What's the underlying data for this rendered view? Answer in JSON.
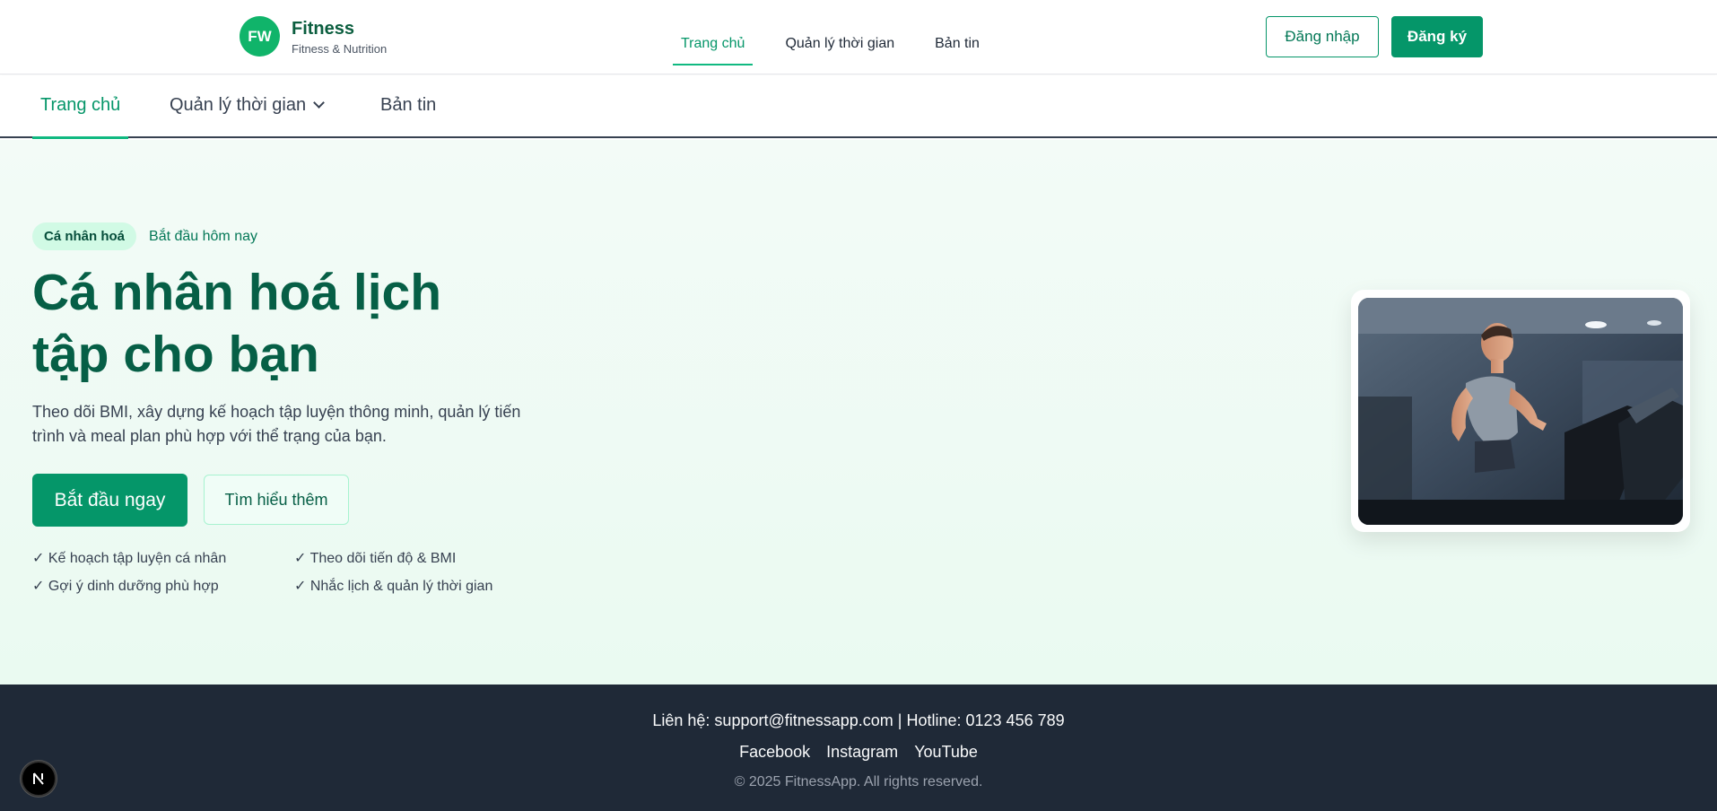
{
  "brand": {
    "logo_text": "FW",
    "name": "Fitness",
    "subtitle": "Fitness & Nutrition",
    "logo_color": "#10b46a"
  },
  "top_nav": {
    "items": [
      {
        "label": "Trang chủ",
        "active": true
      },
      {
        "label": "Quản lý thời gian",
        "active": false
      },
      {
        "label": "Bản tin",
        "active": false
      }
    ]
  },
  "auth": {
    "login_label": "Đăng nhập",
    "register_label": "Đăng ký"
  },
  "sub_nav": {
    "items": [
      {
        "label": "Trang chủ",
        "active": true
      },
      {
        "label": "Quản lý thời gian",
        "active": false,
        "has_dropdown": true
      },
      {
        "label": "Bản tin",
        "active": false
      }
    ]
  },
  "hero": {
    "pill": "Cá nhân hoá",
    "tagline": "Bắt đầu hôm nay",
    "headline_line1": "Cá nhân hoá lịch",
    "headline_line2": "tập cho bạn",
    "description": "Theo dõi BMI, xây dựng kế hoạch tập luyện thông minh, quản lý tiến trình và meal plan phù hợp với thể trạng của bạn.",
    "primary_cta": "Bắt đầu ngay",
    "secondary_cta": "Tìm hiểu thêm",
    "features": [
      "✓ Kế hoạch tập luyện cá nhân",
      "✓ Theo dõi tiến độ & BMI",
      "✓ Gợi ý dinh dưỡng phù hợp",
      "✓ Nhắc lịch & quản lý thời gian"
    ]
  },
  "footer": {
    "contact": "Liên hệ: support@fitnessapp.com | Hotline: 0123 456 789",
    "social": [
      "Facebook",
      "Instagram",
      "YouTube"
    ],
    "copyright": "© 2025 FitnessApp. All rights reserved."
  },
  "colors": {
    "primary": "#059669",
    "headline": "#065f46",
    "footer_bg": "#1f2937"
  },
  "icons": {
    "dev_badge": "nextjs-icon",
    "dropdown": "chevron-down-icon"
  }
}
